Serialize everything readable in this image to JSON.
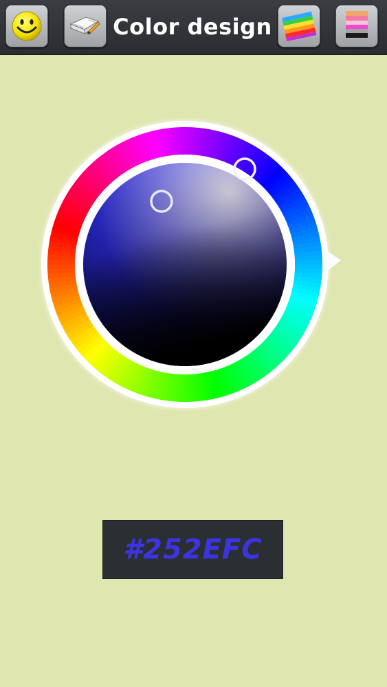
{
  "header": {
    "title": "Color design"
  },
  "toolbar": {
    "left_buttons": [
      {
        "icon": "smiley-icon"
      },
      {
        "icon": "book-pencil-icon"
      }
    ],
    "right_buttons": [
      {
        "icon": "rainbow-icon"
      },
      {
        "icon": "palette-stripes-icon"
      }
    ]
  },
  "color_picker": {
    "hex_value": "#252EFC",
    "selected_color": "#252EFC",
    "hue_degrees": 237,
    "saturation": 0.85,
    "brightness": 0.99
  },
  "colors": {
    "background": "#dfe6b0",
    "toolbar": "#2f3236",
    "hex_box_bg": "#2b2f33",
    "hex_text": "#3a35e0"
  }
}
